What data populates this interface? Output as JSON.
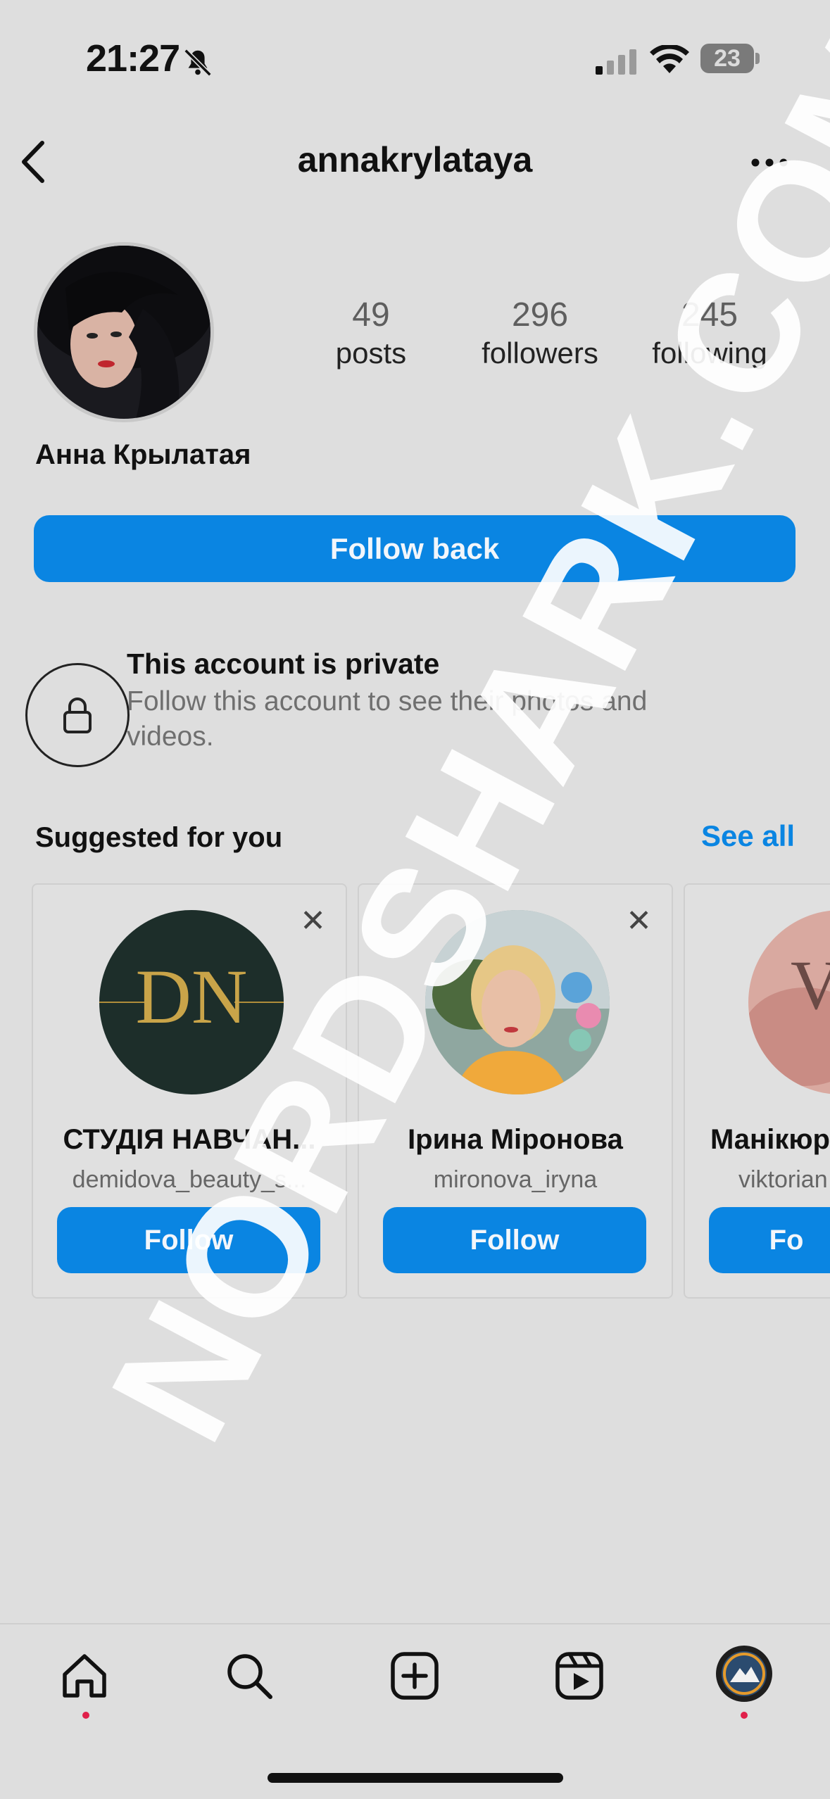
{
  "status_bar": {
    "time": "21:27",
    "battery": "23"
  },
  "header": {
    "username": "annakrylataya"
  },
  "profile": {
    "display_name": "Анна Крылатая",
    "stats": [
      {
        "value": "49",
        "label": "posts"
      },
      {
        "value": "296",
        "label": "followers"
      },
      {
        "value": "245",
        "label": "following"
      }
    ],
    "follow_back_label": "Follow back"
  },
  "private": {
    "title": "This account is private",
    "body": "Follow this account to see their photos and videos."
  },
  "suggested": {
    "title": "Suggested for you",
    "see_all": "See all",
    "cards": [
      {
        "name": "СТУДІЯ НАВЧАН...",
        "username": "demidova_beauty_s...",
        "button": "Follow"
      },
      {
        "name": "Ірина Міронова",
        "username": "mironova_iryna",
        "button": "Follow"
      },
      {
        "name": "Манікюр",
        "username": "viktorian",
        "button": "Fo"
      }
    ]
  },
  "watermark": "NORDSHARK.COM",
  "colors": {
    "accent": "#0a85e2",
    "background": "#dedede",
    "notification_dot": "#e0204a"
  }
}
